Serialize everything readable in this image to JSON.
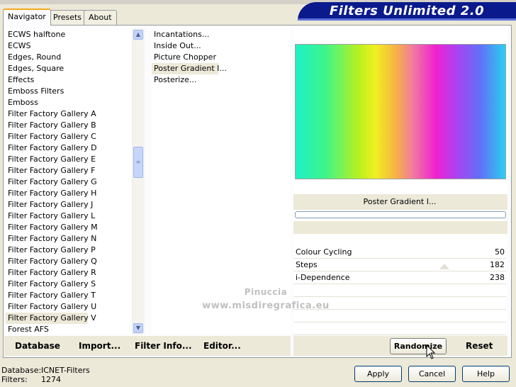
{
  "brand": {
    "title": "Filters Unlimited 2.0"
  },
  "tabs": [
    {
      "label": "Navigator"
    },
    {
      "label": "Presets"
    },
    {
      "label": "About"
    }
  ],
  "categories": {
    "items": [
      "ECWS halftone",
      "ECWS",
      "Edges, Round",
      "Edges, Square",
      "Effects",
      "Emboss Filters",
      "Emboss",
      "Filter Factory Gallery A",
      "Filter Factory Gallery B",
      "Filter Factory Gallery C",
      "Filter Factory Gallery D",
      "Filter Factory Gallery E",
      "Filter Factory Gallery F",
      "Filter Factory Gallery G",
      "Filter Factory Gallery H",
      "Filter Factory Gallery J",
      "Filter Factory Gallery L",
      "Filter Factory Gallery M",
      "Filter Factory Gallery N",
      "Filter Factory Gallery P",
      "Filter Factory Gallery Q",
      "Filter Factory Gallery R",
      "Filter Factory Gallery S",
      "Filter Factory Gallery T",
      "Filter Factory Gallery U",
      "Filter Factory Gallery V",
      "Forest AFS"
    ],
    "selected": "Filter Factory Gallery V"
  },
  "filters": {
    "items": [
      "Incantations...",
      "Inside Out...",
      "Picture Chopper",
      "Poster Gradient I...",
      "Posterize..."
    ],
    "selected": "Poster Gradient I..."
  },
  "preview": {
    "filter_name": "Poster Gradient I..."
  },
  "params": [
    {
      "name": "Colour Cycling",
      "value": "50"
    },
    {
      "name": "Steps",
      "value": "182"
    },
    {
      "name": "i-Dependence",
      "value": "238"
    }
  ],
  "list_buttons": {
    "database": "Database",
    "import": "Import...",
    "filter_info": "Filter Info...",
    "editor": "Editor..."
  },
  "param_buttons": {
    "randomize": "Randomize",
    "reset": "Reset"
  },
  "status": {
    "database_label": "Database:",
    "database_value": "ICNET-Filters",
    "filters_label": "Filters:",
    "filters_value": "1274"
  },
  "dialog_buttons": {
    "apply": "Apply",
    "cancel": "Cancel",
    "help": "Help"
  },
  "watermark": {
    "line1": "Pinuccia",
    "line2": "www.misdiregrafica.eu"
  },
  "icons": {
    "scroll_up": "scroll-up-arrow-icon",
    "scroll_down": "scroll-down-arrow-icon",
    "cursor": "mouse-pointer-icon"
  },
  "colors": {
    "brand_bg": "#0a1a8c",
    "active_tab_accent": "#f5a91e",
    "selection": "#ece9d8"
  }
}
